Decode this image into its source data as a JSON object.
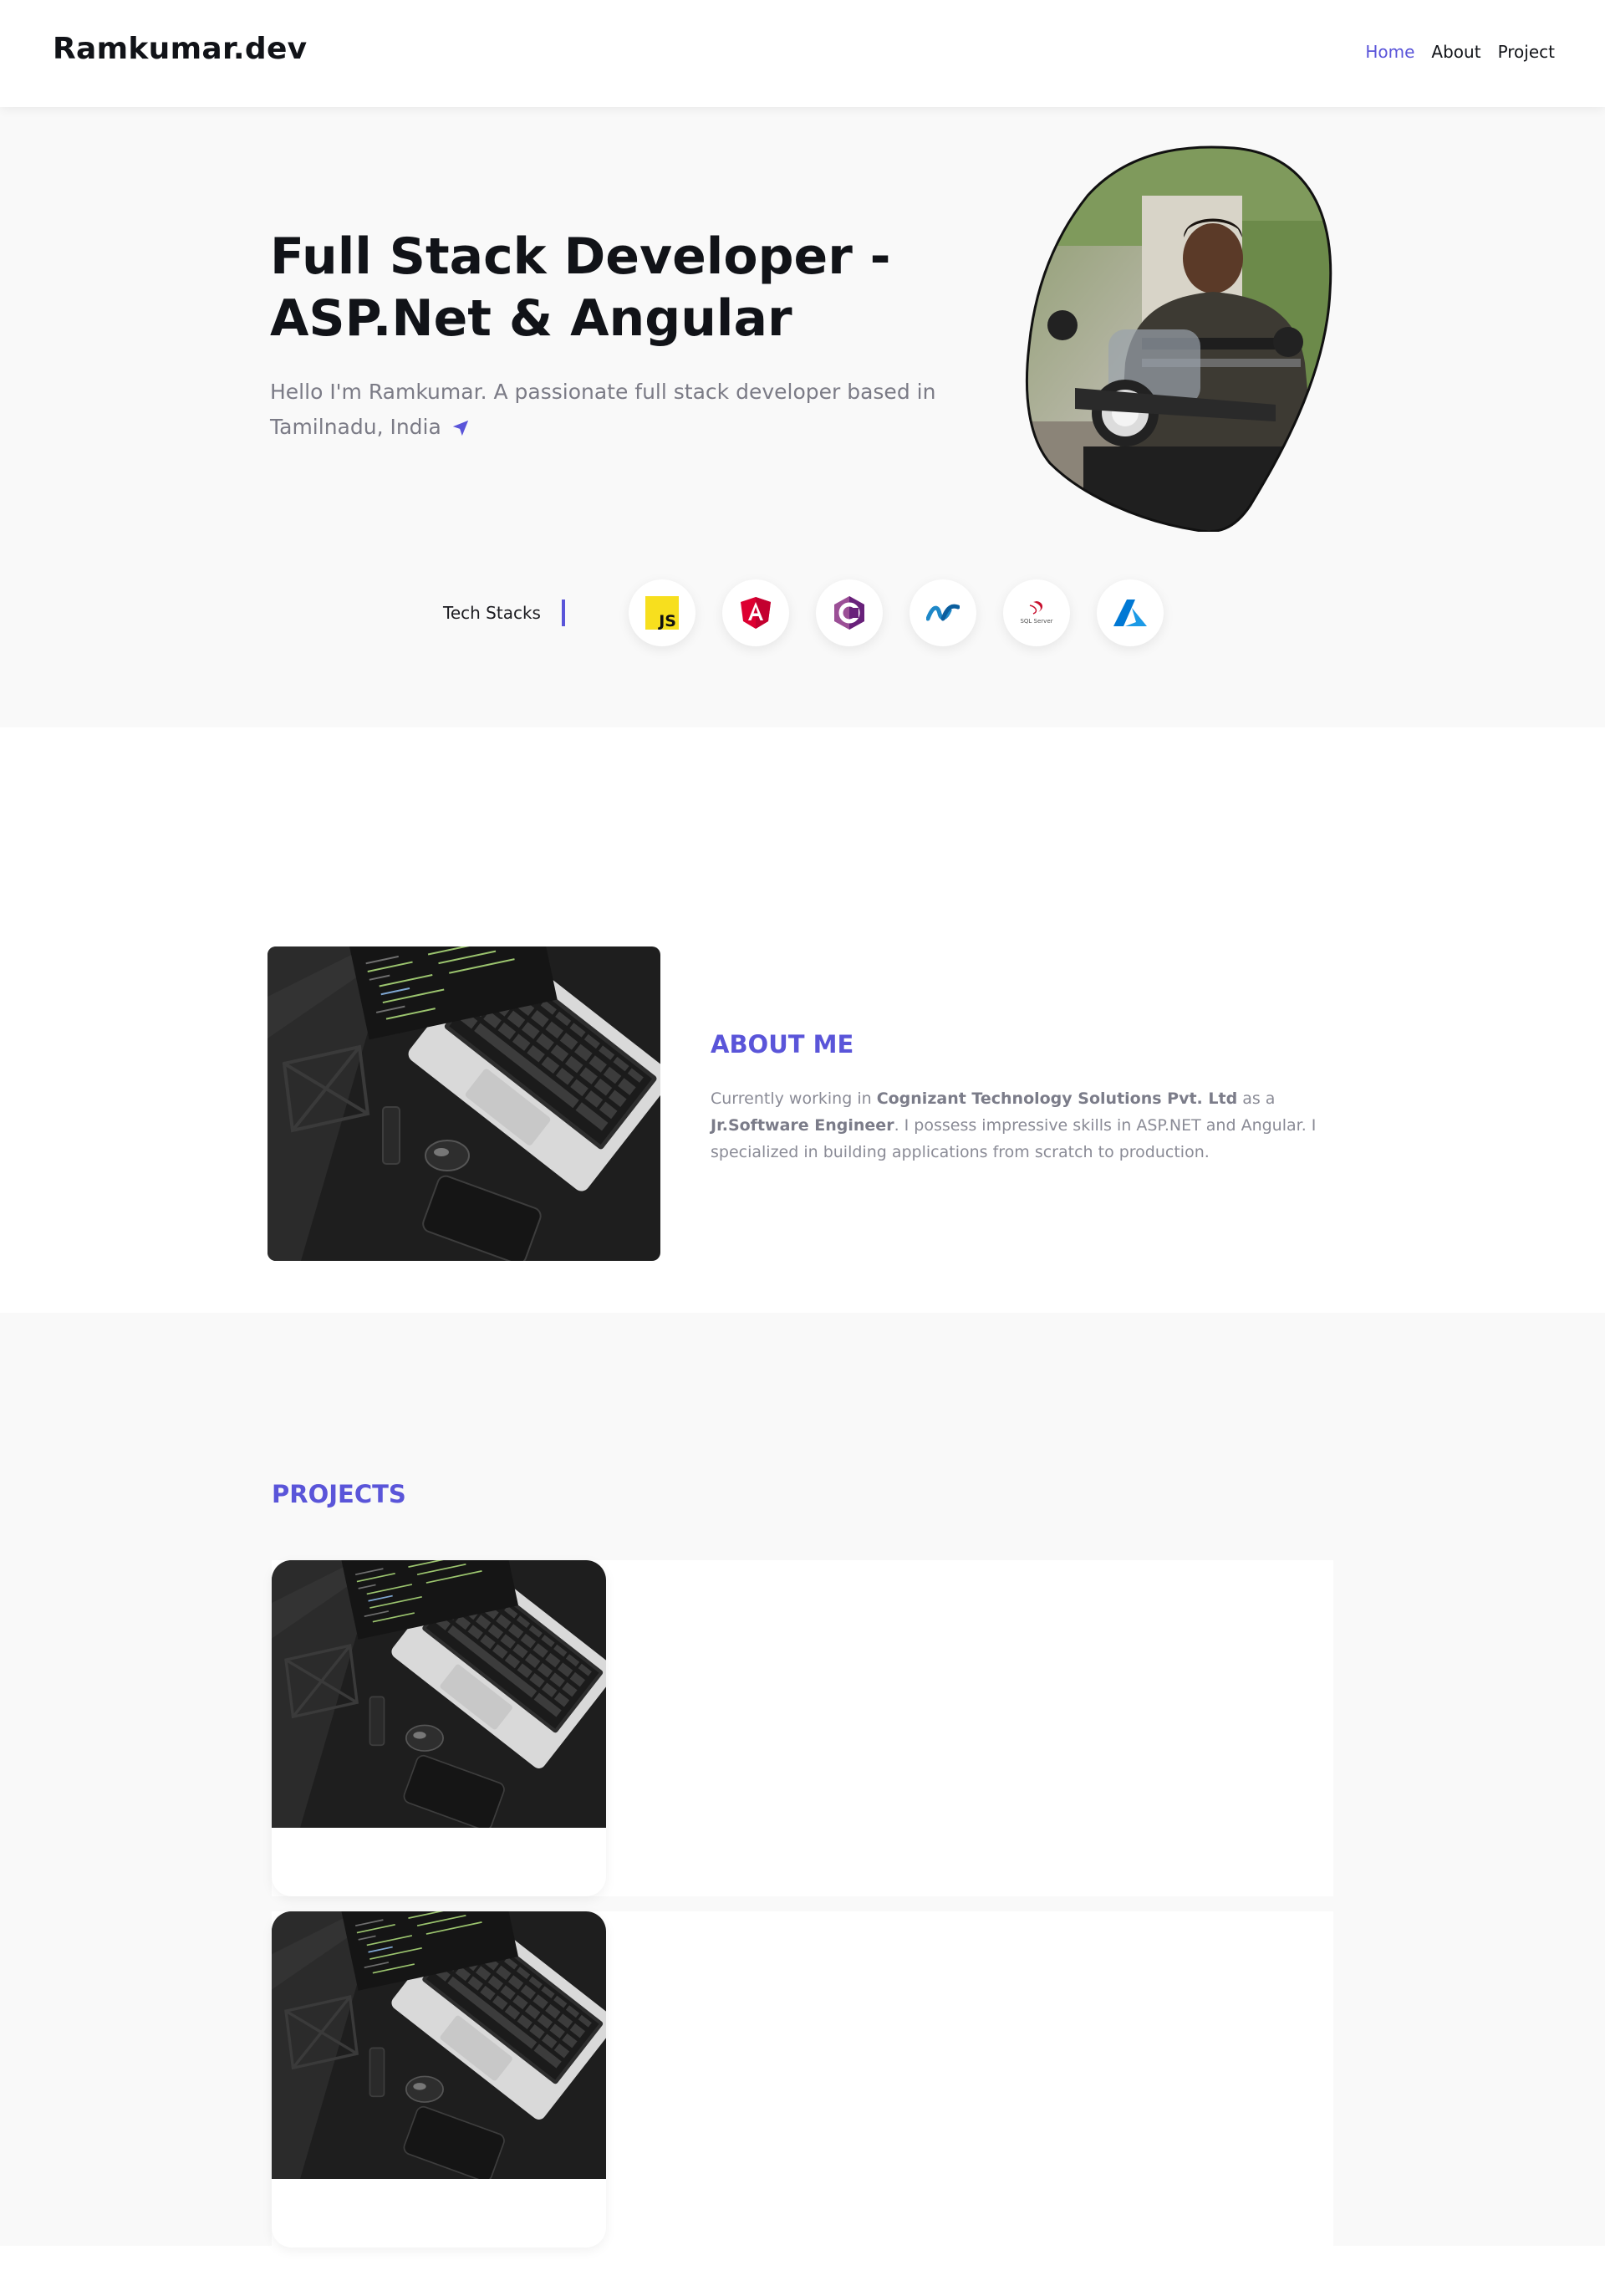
{
  "nav": {
    "brand": "Ramkumar.dev",
    "links": [
      "Home",
      "About",
      "Project"
    ],
    "active": "Home"
  },
  "hero": {
    "title_line1": "Full Stack Developer -",
    "title_line2": "ASP.Net & Angular",
    "intro_line1": "Hello I'm Ramkumar. A passionate full stack developer based in",
    "intro_line2": "Tamilnadu, India",
    "tech_label": "Tech Stacks",
    "tech_icons": [
      "javascript-icon",
      "angular-icon",
      "csharp-icon",
      "dotnet-icon",
      "sql-server-icon",
      "azure-icon"
    ],
    "js_text": "JS",
    "sql_text": "SQL Server"
  },
  "about": {
    "heading": "ABOUT ME",
    "text_before_company": "Currently working in ",
    "company": "Cognizant Technology Solutions Pvt. Ltd",
    "text_as": " as a ",
    "role": "Jr.Software Engineer",
    "text_after": ". I possess impressive skills in ASP.NET and Angular. I specialized in building applications from scratch to production."
  },
  "projects": {
    "heading": "PROJECTS",
    "items": [
      {
        "title": ""
      },
      {
        "title": ""
      }
    ]
  },
  "colors": {
    "accent": "#5a55d9",
    "hero_bg": "#f9f9f9",
    "text": "#111318",
    "muted": "#7b7b86"
  }
}
